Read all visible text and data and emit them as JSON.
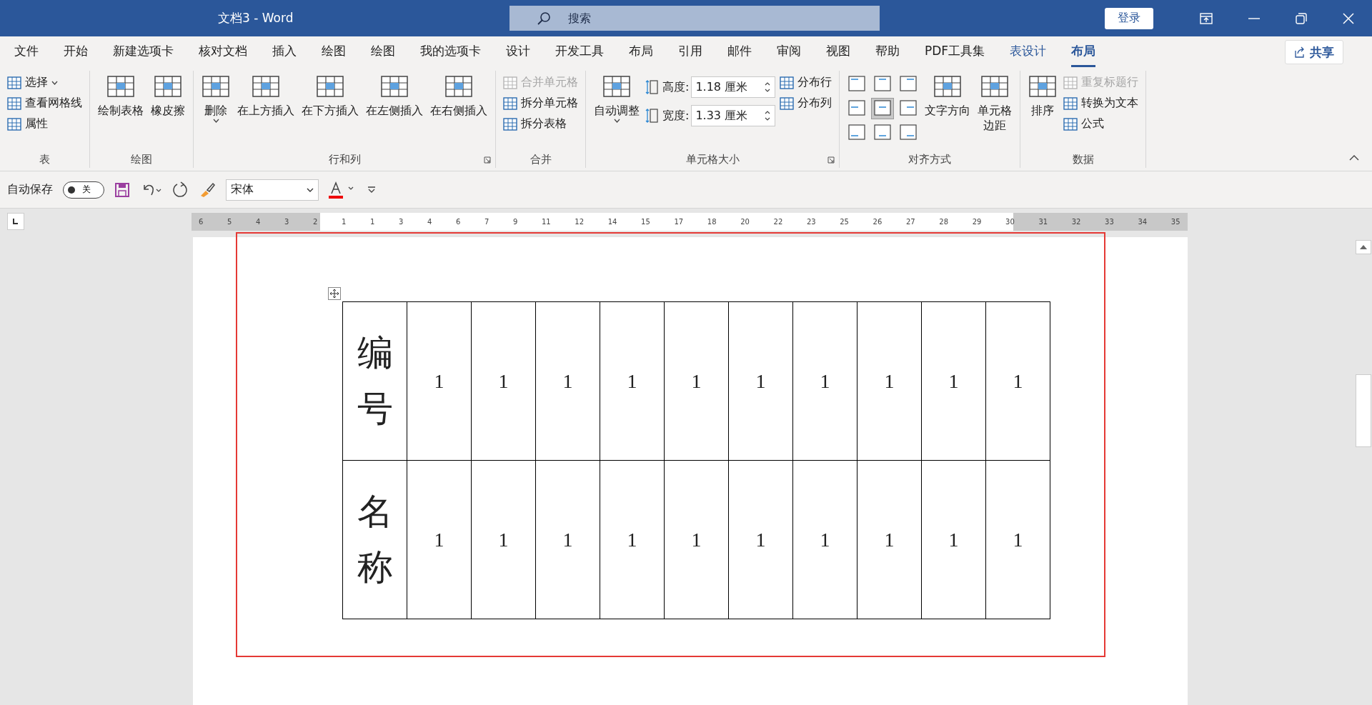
{
  "window": {
    "title": "文档3  -  Word",
    "search": {
      "placeholder": "搜索"
    },
    "sign_in": "登录"
  },
  "tabs": [
    {
      "label": "文件",
      "selected": false,
      "contextual": false
    },
    {
      "label": "开始",
      "selected": false,
      "contextual": false
    },
    {
      "label": "新建选项卡",
      "selected": false,
      "contextual": false
    },
    {
      "label": "核对文档",
      "selected": false,
      "contextual": false
    },
    {
      "label": "插入",
      "selected": false,
      "contextual": false
    },
    {
      "label": "绘图",
      "selected": false,
      "contextual": false
    },
    {
      "label": "绘图",
      "selected": false,
      "contextual": false
    },
    {
      "label": "我的选项卡",
      "selected": false,
      "contextual": false
    },
    {
      "label": "设计",
      "selected": false,
      "contextual": false
    },
    {
      "label": "开发工具",
      "selected": false,
      "contextual": false
    },
    {
      "label": "布局",
      "selected": false,
      "contextual": false
    },
    {
      "label": "引用",
      "selected": false,
      "contextual": false
    },
    {
      "label": "邮件",
      "selected": false,
      "contextual": false
    },
    {
      "label": "审阅",
      "selected": false,
      "contextual": false
    },
    {
      "label": "视图",
      "selected": false,
      "contextual": false
    },
    {
      "label": "帮助",
      "selected": false,
      "contextual": false
    },
    {
      "label": "PDF工具集",
      "selected": false,
      "contextual": false
    },
    {
      "label": "表设计",
      "selected": false,
      "contextual": true
    },
    {
      "label": "布局",
      "selected": true,
      "contextual": true
    }
  ],
  "share": "共享",
  "ribbon": [
    {
      "name": "表",
      "launcher": false,
      "columns": [
        {
          "kind": "stack",
          "items": [
            {
              "label": "选择",
              "disabled": false,
              "caret": true
            },
            {
              "label": "查看网格线",
              "disabled": false,
              "caret": false
            },
            {
              "label": "属性",
              "disabled": false,
              "caret": false
            }
          ]
        }
      ]
    },
    {
      "name": "绘图",
      "launcher": false,
      "columns": [
        {
          "kind": "large",
          "label": "绘制表格",
          "caret": false
        },
        {
          "kind": "large",
          "label": "橡皮擦",
          "caret": false
        }
      ]
    },
    {
      "name": "行和列",
      "launcher": true,
      "columns": [
        {
          "kind": "large",
          "label": "删除",
          "caret": true
        },
        {
          "kind": "large",
          "label": "在上方插入",
          "caret": false
        },
        {
          "kind": "large",
          "label": "在下方插入",
          "caret": false
        },
        {
          "kind": "large",
          "label": "在左侧插入",
          "caret": false
        },
        {
          "kind": "large",
          "label": "在右侧插入",
          "caret": false
        }
      ]
    },
    {
      "name": "合并",
      "launcher": false,
      "columns": [
        {
          "kind": "stack",
          "items": [
            {
              "label": "合并单元格",
              "disabled": true,
              "caret": false
            },
            {
              "label": "拆分单元格",
              "disabled": false,
              "caret": false
            },
            {
              "label": "拆分表格",
              "disabled": false,
              "caret": false
            }
          ]
        }
      ]
    },
    {
      "name": "单元格大小",
      "launcher": true,
      "columns": [
        {
          "kind": "large",
          "label": "自动调整",
          "caret": true
        },
        {
          "kind": "fields",
          "items": [
            {
              "label": "高度:",
              "value": "1.18 厘米"
            },
            {
              "label": "宽度:",
              "value": "1.33 厘米"
            }
          ]
        },
        {
          "kind": "stack",
          "items": [
            {
              "label": "分布行",
              "disabled": false,
              "caret": false
            },
            {
              "label": "分布列",
              "disabled": false,
              "caret": false
            }
          ]
        }
      ]
    },
    {
      "name": "对齐方式",
      "launcher": false,
      "columns": [
        {
          "kind": "align",
          "buttons": [
            {
              "selected": false
            },
            {
              "selected": false
            },
            {
              "selected": false
            },
            {
              "selected": false
            },
            {
              "selected": true
            },
            {
              "selected": false
            },
            {
              "selected": false
            },
            {
              "selected": false
            },
            {
              "selected": false
            }
          ]
        },
        {
          "kind": "large",
          "label": "文字方向",
          "caret": false
        },
        {
          "kind": "large",
          "lines": [
            "单元格",
            "边距"
          ],
          "caret": false
        }
      ]
    },
    {
      "name": "数据",
      "launcher": false,
      "columns": [
        {
          "kind": "large",
          "label": "排序",
          "caret": false
        },
        {
          "kind": "stack",
          "items": [
            {
              "label": "重复标题行",
              "disabled": true,
              "caret": false
            },
            {
              "label": "转换为文本",
              "disabled": false,
              "caret": false
            },
            {
              "label": "公式",
              "disabled": false,
              "caret": false
            }
          ]
        }
      ]
    }
  ],
  "quick_access": {
    "autosave_label": "自动保存",
    "autosave": {
      "on": false,
      "label": "关"
    },
    "font": "宋体"
  },
  "ruler": [
    "6",
    "5",
    "4",
    "3",
    "2",
    "1",
    "1",
    "3",
    "4",
    "6",
    "7",
    "9",
    "11",
    "12",
    "14",
    "15",
    "17",
    "18",
    "20",
    "22",
    "23",
    "25",
    "26",
    "27",
    "28",
    "29",
    "30",
    "31",
    "32",
    "33",
    "34",
    "35"
  ],
  "table": {
    "rows": [
      {
        "header": "编号",
        "cells": [
          "1",
          "1",
          "1",
          "1",
          "1",
          "1",
          "1",
          "1",
          "1",
          "1"
        ]
      },
      {
        "header": "名称",
        "cells": [
          "1",
          "1",
          "1",
          "1",
          "1",
          "1",
          "1",
          "1",
          "1",
          "1"
        ]
      }
    ]
  }
}
